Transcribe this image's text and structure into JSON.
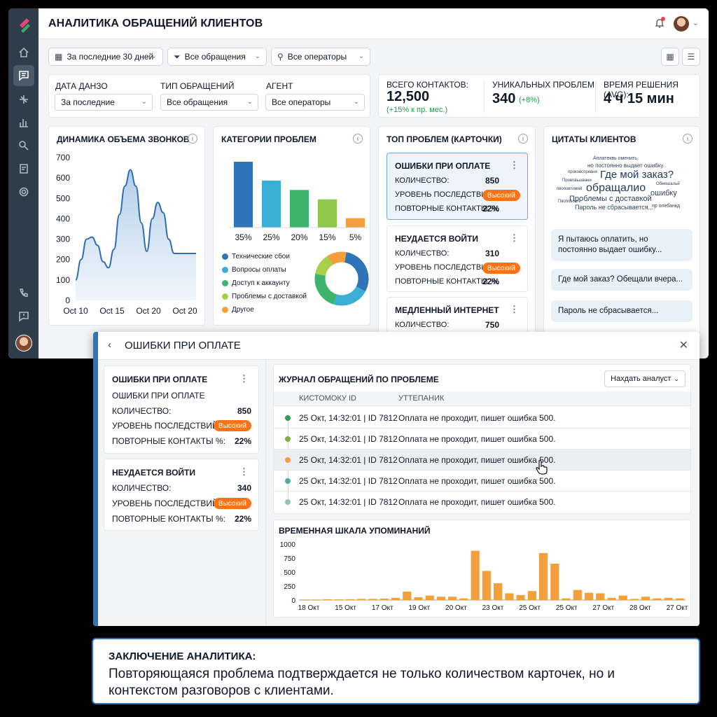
{
  "header": {
    "title": "АНАЛИТИКА ОБРАЩЕНИЙ КЛИЕНТОВ"
  },
  "filters_top": {
    "period": "За последние 30 дней",
    "requests": "Все обращения",
    "operators": "Все операторы"
  },
  "filter_panel": {
    "date_label": "ДАТА ДАНЗО",
    "date_value": "За последние",
    "type_label": "ТИП ОБРАЩЕНИЙ",
    "type_value": "Все обращения",
    "agent_label": "АГЕНТ",
    "agent_value": "Все операторы"
  },
  "kpis": {
    "total_label": "ВСЕГО КОНТАКТОВ:",
    "total_value": "12,500",
    "total_delta": "(+15% к пр. мес.)",
    "unique_label": "УНИКАЛЬНЫХ ПРОБЛЕМ:",
    "unique_value": "340",
    "unique_delta": "(+8%)",
    "time_label": "ВРЕМЯ РЕШЕНИЯ (AVG):",
    "time_value": "4 ч 15 мин"
  },
  "calls_card": {
    "title": "ДИНАМИКА ОБЪЕМА ЗВОНКОВ"
  },
  "categories_card": {
    "title": "КАТЕГОРИИ ПРОБЛЕМ",
    "legend": [
      "Технические сбои",
      "Вопросы оплаты",
      "Доступ к аккаунту",
      "Проблемы с доставкой",
      "Другое"
    ]
  },
  "top_card": {
    "title": "ТОП ПРОБЛЕМ (КАРТОЧКИ)",
    "cards": [
      {
        "title": "ОШИБКИ ПРИ ОПЛАТЕ",
        "count_label": "КОЛИЧЕСТВО:",
        "count": "850",
        "impact_label": "УРОВЕНЬ ПОСЛЕДСТВИЙ:",
        "impact": "Высокий",
        "repeat_label": "ПОВТОРНЫЕ КОНТАКТЫ %:",
        "repeat": "22%"
      },
      {
        "title": "НЕУДАЕТСЯ ВОЙТИ",
        "count_label": "КОЛИЧЕСТВО:",
        "count": "310",
        "impact_label": "УРОВЕНЬ ПОСЛЕДСТВИЙ:",
        "impact": "Высокий",
        "repeat_label": "ПОВТОРНЫЕ КОНТАКТЫ %:",
        "repeat": "22%"
      },
      {
        "title": "МЕДЛЕННЫЙ ИНТЕРНЕТ",
        "count_label": "КОЛИЧЕСТВО:",
        "count": "750"
      }
    ]
  },
  "quotes_card": {
    "title": "ЦИТАТЫ КЛИЕНТОВ",
    "cloud": [
      "Аплатеквь оменить,",
      "но постоянно выдает ошибку..",
      "проковспревня",
      "Где мой заказ?",
      "Прововьшвани",
      "обращалио",
      "Обмешальй",
      "пвоповтомий",
      "ошибку",
      "Проблемы с доставкой",
      "Пароль не сбрасывается...",
      "Пвоповоеге",
      "пр олебанкд"
    ],
    "bubbles": [
      "Я пытаюсь оплатить, но постоянно выдает ошибку...",
      "Где мой заказ? Обещали вчера...",
      "Пароль не сбрасывается..."
    ]
  },
  "overlay": {
    "title": "ОШИБКИ ПРИ ОПЛАТЕ",
    "cards": [
      {
        "title": "ОШИБКИ ПРИ ОПЛАТЕ",
        "subtitle": "ОШИБКИ ПРИ ОПЛАТЕ",
        "count_label": "КОЛИЧЕСТВО:",
        "count": "850",
        "impact_label": "УРОВЕНЬ ПОСЛЕДСТВИЙ:",
        "impact": "Высокий",
        "repeat_label": "ПОВТОРНЫЕ КОНТАКТЫ %:",
        "repeat": "22%"
      },
      {
        "title": "НЕУДАЕТСЯ ВОЙТИ",
        "count_label": "КОЛИЧЕСТВО:",
        "count": "340",
        "impact_label": "УРОВЕНЬ ПОСЛЕДСТВИЙ:",
        "impact": "Высокий",
        "repeat_label": "ПОВТОРНЫЕ КОНТАКТЫ %:",
        "repeat": "22%"
      }
    ],
    "log": {
      "title": "ЖУРНАЛ ОБРАЩЕНИЙ ПО ПРОБЛЕМЕ",
      "button": "Нахдать аналуст",
      "col_id": "КИСТОМОКУ ID",
      "col_text": "УТТЕПАНИК",
      "rows": [
        {
          "id": "25 Окт, 14:32:01 | ID 7812",
          "text": "Оплата не проходит, пишет ошибка 500.",
          "color": "#2e9e50"
        },
        {
          "id": "25 Окт, 14:32:01 | ID 7812",
          "text": "Оплата не проходит, пишет ошибка 500.",
          "color": "#7cb342"
        },
        {
          "id": "25 Окт, 14:32:01 | ID 7812",
          "text": "Оплата не проходит, пишет ошибка 500.",
          "color": "#f59e42"
        },
        {
          "id": "25 Окт, 14:32:01 | ID 7812",
          "text": "Оплата не проходит, пишет ошибка 500.",
          "color": "#4fa9a0"
        },
        {
          "id": "25 Окт, 14:32:01 | ID 7812",
          "text": "Оплата не проходит, пишет ошибка 500.",
          "color": "#8fc7a8"
        }
      ]
    },
    "timeline": {
      "title": "ВРЕМЕННАЯ ШКАЛА УПОМИНАНИЙ"
    }
  },
  "conclusion": {
    "title": "ЗАКЛЮЧЕНИЕ АНАЛИТИКА:",
    "text": "Повторяющаяся проблема подтверждается не только количеством карточек, но и контекстом разговоров с клиентами."
  },
  "chart_data": [
    {
      "type": "area",
      "title": "ДИНАМИКА ОБЪЕМА ЗВОНКОВ",
      "x_ticks": [
        "Oct 10",
        "Oct 15",
        "Oct 20",
        "Oct 20"
      ],
      "y_ticks": [
        0,
        100,
        200,
        300,
        400,
        500,
        600,
        700
      ],
      "ylim": [
        0,
        700
      ],
      "x": [
        0,
        0.5,
        1,
        1.5,
        2,
        2.5,
        3,
        3.5,
        4,
        4.5,
        5,
        5.5,
        6,
        6.5,
        7,
        7.5,
        8,
        8.5,
        9,
        9.5,
        10,
        10.5,
        11
      ],
      "values": [
        100,
        200,
        300,
        310,
        270,
        190,
        160,
        250,
        420,
        560,
        640,
        560,
        380,
        240,
        400,
        480,
        430,
        300,
        230,
        230,
        230,
        230,
        230
      ],
      "color": "#2f6fb0"
    },
    {
      "type": "bar",
      "title": "КАТЕГОРИИ ПРОБЛЕМ",
      "categories": [
        "Технические сбои",
        "Вопросы оплаты",
        "Доступ к аккаунту",
        "Проблемы с доставкой",
        "Другое"
      ],
      "tick_labels": [
        "35%",
        "25%",
        "20%",
        "15%",
        "5%"
      ],
      "values": [
        35,
        25,
        20,
        15,
        5
      ],
      "colors": [
        "#2f74b8",
        "#3aaed4",
        "#3db36b",
        "#8fc74a",
        "#f59e3c"
      ]
    },
    {
      "type": "pie",
      "donut": true,
      "categories": [
        "Технические сбои",
        "Вопросы оплаты",
        "Доступ к аккаунту",
        "Проблемы с доставкой",
        "Другое"
      ],
      "values": [
        30,
        22,
        23,
        13,
        12
      ],
      "colors": [
        "#2f74b8",
        "#3aaed4",
        "#3db36b",
        "#a8cf4a",
        "#f59e3c"
      ]
    },
    {
      "type": "bar",
      "title": "ВРЕМЕННАЯ ШКАЛА УПОМИНАНИЙ",
      "ylim": [
        0,
        1000
      ],
      "y_ticks": [
        0,
        250,
        500,
        750,
        1000
      ],
      "x_ticks": [
        "18 Окт",
        "15 Окт",
        "17 Окт",
        "19 Окт",
        "20 Окт",
        "23 Окт",
        "25 Окт",
        "25 Окт",
        "27 Окт",
        "28 Окт",
        "27 Окт"
      ],
      "values": [
        10,
        10,
        15,
        12,
        15,
        20,
        20,
        25,
        40,
        150,
        50,
        80,
        60,
        60,
        30,
        880,
        520,
        300,
        120,
        90,
        160,
        840,
        650,
        30,
        180,
        130,
        120,
        40,
        80,
        20,
        60,
        30,
        40,
        30
      ],
      "color": "#f59e3c"
    }
  ]
}
